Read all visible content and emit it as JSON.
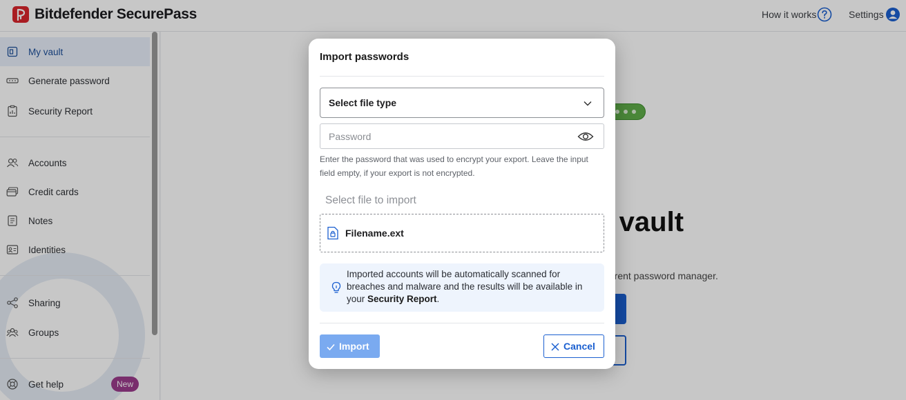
{
  "app": {
    "title": "Bitdefender SecurePass",
    "logo_icon": "bitdefender-logo-icon",
    "brand_color": "#d9262c"
  },
  "topbar": {
    "how_it_works": "How it works",
    "help_icon": "question-circle-icon",
    "settings": "Settings",
    "user_icon": "user-avatar-icon"
  },
  "sidebar": {
    "items": [
      {
        "label": "My vault",
        "icon": "vault-icon",
        "active": true
      },
      {
        "label": "Generate password",
        "icon": "password-dots-icon"
      },
      {
        "label": "Security Report",
        "icon": "report-clipboard-icon"
      },
      {
        "label": "Accounts",
        "icon": "accounts-users-icon"
      },
      {
        "label": "Credit cards",
        "icon": "credit-card-icon"
      },
      {
        "label": "Notes",
        "icon": "note-icon"
      },
      {
        "label": "Identities",
        "icon": "identity-card-icon"
      },
      {
        "label": "Sharing",
        "icon": "share-icon"
      },
      {
        "label": "Groups",
        "icon": "groups-icon"
      },
      {
        "label": "Get help",
        "icon": "help-lifebuoy-icon",
        "badge": "New"
      }
    ]
  },
  "background": {
    "title_fragment": "r vault",
    "subtitle_fragment": "rrent password manager."
  },
  "modal": {
    "title": "Import passwords",
    "select": {
      "value": "Select file type",
      "icon": "chevron-down-icon"
    },
    "password": {
      "placeholder": "Password",
      "value": "",
      "icon": "eye-icon"
    },
    "hint": "Enter the password that was used to encrypt your export. Leave the input field empty, if your export is not encrypted.",
    "file_section_label": "Select file to import",
    "file": {
      "name": "Filename.ext",
      "icon": "locked-file-icon"
    },
    "info": {
      "icon": "lightbulb-icon",
      "text_before": "Imported accounts will be automatically scanned for breaches and malware and the results will be available in your ",
      "text_bold": "Security Report",
      "text_after": "."
    },
    "import_button": {
      "label": "Import",
      "icon": "checkmark-icon",
      "disabled": true
    },
    "cancel_button": {
      "label": "Cancel",
      "icon": "close-icon"
    }
  },
  "colors": {
    "accent": "#1a5fd0",
    "import_disabled": "#7aaaf0",
    "active_nav_bg": "#e8effa",
    "badge": "#9c3c8c"
  }
}
